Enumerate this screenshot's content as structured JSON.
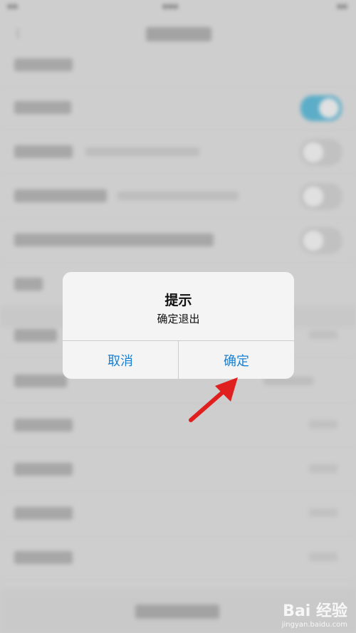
{
  "dialog": {
    "title": "提示",
    "message": "确定退出",
    "cancel_label": "取消",
    "confirm_label": "确定"
  },
  "watermark": {
    "brand": "Bai 经验",
    "url": "jingyan.baidu.com"
  },
  "colors": {
    "accent": "#1a7fd0",
    "annotation_arrow": "#e0201f",
    "toggle_on": "#5fb3cf"
  }
}
